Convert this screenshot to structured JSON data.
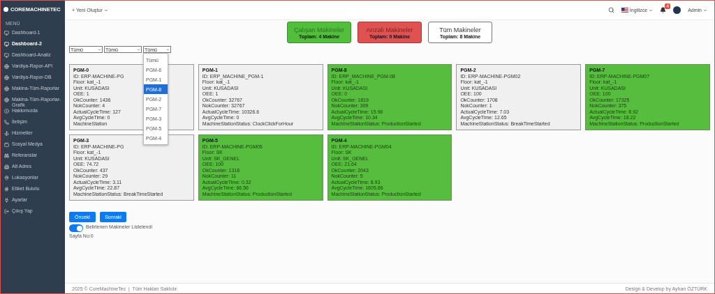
{
  "brand": "COREMACHINETEC",
  "sidebar": {
    "heading": "MENÜ",
    "items": [
      {
        "label": "Dashboard-1",
        "selected": false
      },
      {
        "label": "Dashboard-2",
        "selected": true
      },
      {
        "label": "Dashboard-Analiz",
        "selected": false
      },
      {
        "label": "Vardiya-Rapor-API",
        "selected": false
      },
      {
        "label": "Vardiya-Rapor-DB",
        "selected": false
      },
      {
        "label": "Makina-Tüm-Raporlar",
        "selected": false
      },
      {
        "label": "Makina-Tüm-Raporlar-Grafik",
        "selected": false
      },
      {
        "label": "Hakkımızda",
        "selected": false
      },
      {
        "label": "İletişim",
        "selected": false
      },
      {
        "label": "Hizmetler",
        "selected": false
      },
      {
        "label": "Sosyal Medya",
        "selected": false
      },
      {
        "label": "Referanslar",
        "selected": false
      },
      {
        "label": "Alt Adres",
        "selected": false
      },
      {
        "label": "Lokasyonlar",
        "selected": false
      },
      {
        "label": "Etiket Bulutu",
        "selected": false
      },
      {
        "label": "Ayarlar",
        "selected": false
      },
      {
        "label": "Çıkış Yap",
        "selected": false
      }
    ]
  },
  "header": {
    "create": "+ Yeni Oluştur",
    "language": "İngilizce",
    "notifications": "4",
    "user": "Admin"
  },
  "summary": [
    {
      "title": "Çalışan Makineler",
      "total": "Toplam: 4 Makine",
      "kind": "running"
    },
    {
      "title": "Arızalı Makineler",
      "total": "Toplam: 0 Makine",
      "kind": "faulty"
    },
    {
      "title": "Tüm Makineler",
      "total": "Toplam: 8 Makine",
      "kind": "all"
    }
  ],
  "filters": [
    "Tümü",
    "Tümü",
    "Tümü"
  ],
  "open_dropdown": {
    "options": [
      {
        "label": "Tümü",
        "selected": false
      },
      {
        "label": "PGM-6",
        "selected": false
      },
      {
        "label": "PGM-1",
        "selected": false
      },
      {
        "label": "PGM-8",
        "selected": true
      },
      {
        "label": "PGM-2",
        "selected": false
      },
      {
        "label": "PGM-7",
        "selected": false
      },
      {
        "label": "PGM-3",
        "selected": false
      },
      {
        "label": "PGM-5",
        "selected": false
      },
      {
        "label": "PGM-4",
        "selected": false
      }
    ]
  },
  "machines": [
    {
      "name": "PGM-0",
      "kind": "idle",
      "lines": [
        "ID: ERP-MACHINE-PG",
        "Floor: kat_-1",
        "Unit: KUSADASI",
        "OEE: 1",
        "OkCounter: 1436",
        "NokCounter: 4",
        "ActualCycleTime: 127",
        "AvgCycleTime: 0",
        "MachineStation"
      ]
    },
    {
      "name": "PGM-1",
      "kind": "idle",
      "lines": [
        "ID: ERP_MACHINE_PGM-1",
        "Floor: kat_-1",
        "Unit: KUSADASI",
        "OEE: 1",
        "OkCounter: 32767",
        "NokCounter: 32767",
        "ActualCycleTime: 10326.6",
        "AvgCycleTime: 0",
        "MachineStationStatus: ClockClickForHour"
      ]
    },
    {
      "name": "PGM-8",
      "kind": "running",
      "lines": [
        "ID: ERP_MACHINE_PGM-08",
        "Floor: kat_-1",
        "Unit: KUSADASI",
        "OEE: 0",
        "OkCounter: 1819",
        "NokCounter: 309",
        "ActualCycleTime: 15.98",
        "AvgCycleTime: 10.34",
        "MachineStationStatus: ProductionStarted"
      ]
    },
    {
      "name": "PGM-2",
      "kind": "idle",
      "lines": [
        "ID: ERP-MACHINE-PGM02",
        "Floor: kat_-1",
        "Unit: KUSADASI",
        "OEE: 100",
        "OkCounter: 1708",
        "NokCounter: 1",
        "ActualCycleTime: 7.03",
        "AvgCycleTime: 12.65",
        "MachineStationStatus: BreakTimeStarted"
      ]
    },
    {
      "name": "PGM-7",
      "kind": "running",
      "lines": [
        "ID: ERP-MACHINE-PGM07",
        "Floor: kat_-1",
        "Unit: KUSADASI",
        "OEE: 100",
        "OkCounter: 17325",
        "NokCounter: 375",
        "ActualCycleTime: 8.92",
        "AvgCycleTime: 18.22",
        "MachineStationStatus: ProductionStarted"
      ]
    },
    {
      "name": "PGM-3",
      "kind": "idle",
      "lines": [
        "ID: ERP-MACHINE-PG",
        "Floor: kat_-1",
        "Unit: KUSADASI",
        "OEE: 74.72",
        "OkCounter: 437",
        "NokCounter: 29",
        "ActualCycleTime: 3.11",
        "AvgCycleTime: 22.87",
        "MachineStationStatus: BreakTimeStarted"
      ]
    },
    {
      "name": "PGM-5",
      "kind": "running",
      "lines": [
        "ID: ERP-MACHINE-PGM05",
        "Floor: SK",
        "Unit: SK_GENEL",
        "OEE: 100",
        "OkCounter: 1318",
        "NokCounter: 11",
        "ActualCycleTime: 0.32",
        "AvgCycleTime: 66.56",
        "MachineStationStatus: ProductionStarted"
      ]
    },
    {
      "name": "PGM-4",
      "kind": "running",
      "lines": [
        "ID: ERP-MACHINE-PGM04",
        "Floor: SK",
        "Unit: SK_GENEL",
        "OEE: 21.64",
        "OkCounter: 2043",
        "NokCounter: 5",
        "ActualCycleTime: 8.93",
        "AvgCycleTime: 1605.86",
        "MachineStationStatus: ProductionStarted"
      ]
    }
  ],
  "pager": {
    "prev": "Önceki",
    "next": "Sonraki",
    "toggle_label": "Belirlenen Makineler Listelendi",
    "toggle_on": true,
    "page": "Sayfa No:0"
  },
  "footer": {
    "left": "2025 © CoreMachineTec  |  Tüm Hakları Saklıdır.",
    "right": "Design & Develop by Ayhan ÖZTÜRK"
  }
}
